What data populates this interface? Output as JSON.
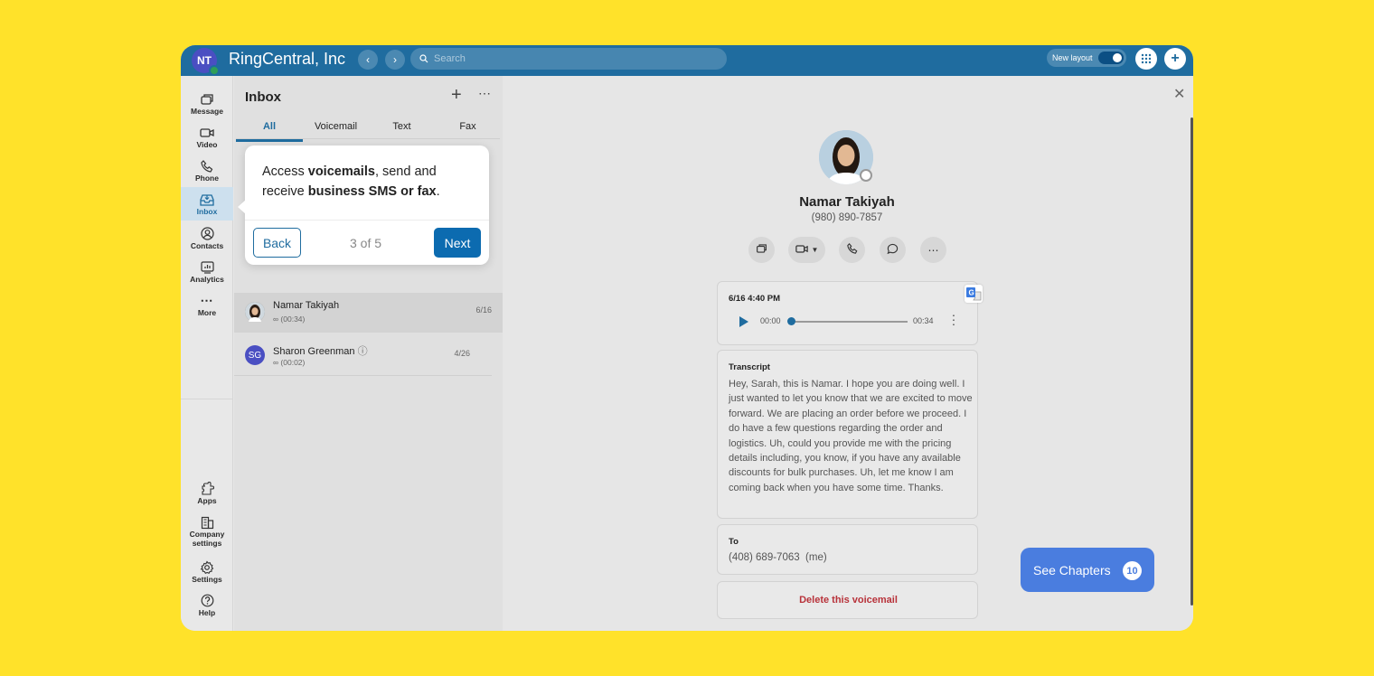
{
  "topbar": {
    "avatar_initials": "NT",
    "company": "RingCentral, Inc",
    "search_placeholder": "Search",
    "new_layout_label": "New layout"
  },
  "rail": {
    "items": [
      {
        "label": "Message",
        "icon": "message-icon"
      },
      {
        "label": "Video",
        "icon": "video-icon"
      },
      {
        "label": "Phone",
        "icon": "phone-icon"
      },
      {
        "label": "Inbox",
        "icon": "inbox-icon"
      },
      {
        "label": "Contacts",
        "icon": "contacts-icon"
      },
      {
        "label": "Analytics",
        "icon": "analytics-icon"
      },
      {
        "label": "More",
        "icon": "more-icon"
      }
    ],
    "bottom_items": [
      {
        "label": "Apps",
        "icon": "apps-icon"
      },
      {
        "label": "Company settings",
        "icon": "company-settings-icon"
      },
      {
        "label": "Settings",
        "icon": "settings-icon"
      },
      {
        "label": "Help",
        "icon": "help-icon"
      }
    ]
  },
  "inbox": {
    "title": "Inbox",
    "tabs": [
      "All",
      "Voicemail",
      "Text",
      "Fax"
    ],
    "messages": [
      {
        "name": "Namar Takiyah",
        "sub": "(00:34)",
        "date": "6/16"
      },
      {
        "name": "Sharon Greenman",
        "initials": "SG",
        "sub": "(00:02)",
        "date": "4/26"
      }
    ]
  },
  "popover": {
    "text_1": "Access ",
    "text_bold_1": "voicemails",
    "text_2": ", send and receive ",
    "text_bold_2": "business SMS or fax",
    "text_3": ".",
    "back_label": "Back",
    "step": "3 of 5",
    "next_label": "Next"
  },
  "detail": {
    "name": "Namar Takiyah",
    "phone": "(980) 890-7857",
    "voicemail": {
      "time": "6/16 4:40 PM",
      "position": "00:00",
      "duration": "00:34"
    },
    "transcript_label": "Transcript",
    "transcript": "Hey, Sarah, this is Namar. I hope you are doing well. I just wanted to let you know that we are excited to move forward. We are placing an order before we proceed. I do have a few questions regarding the order and logistics. Uh, could you provide me with the pricing details including, you know, if you have any available discounts for bulk purchases. Uh, let me know I am coming back when you have some time. Thanks.",
    "to_label": "To",
    "to_value": "(408) 689-7063  (me)",
    "delete_label": "Delete this voicemail"
  },
  "chapters": {
    "label": "See Chapters",
    "count": "10"
  },
  "colors": {
    "background": "#FFE22A",
    "topbar": "#1f6c9f",
    "accent": "#0c6bb0",
    "chapters": "#4a7ddf",
    "danger": "#b8323a"
  }
}
